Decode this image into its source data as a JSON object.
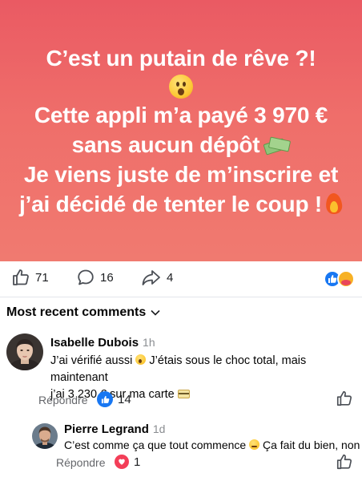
{
  "post": {
    "line1": "C’est un putain de rêve ?!",
    "line2": "Cette appli m’a payé 3 970 €",
    "line3": "sans aucun dépôt",
    "line4": "Je viens juste de m’inscrire et",
    "line5": "j’ai décidé de tenter le coup !",
    "emojis": [
      "astonished-face",
      "money-with-wings",
      "fire"
    ],
    "background_color": "#ea5a63"
  },
  "actions": {
    "likes": "71",
    "comments": "16",
    "shares": "4",
    "reactions": [
      "like",
      "care"
    ]
  },
  "comments_header": {
    "sort_label": "Most recent comments"
  },
  "comments": [
    {
      "author": "Isabelle Dubois",
      "time": "1h",
      "text_line1": "J’ai vérifié aussi",
      "text_line1_b": "J’étais sous le choc total, mais maintenant",
      "text_line2": "j’ai 3 230 € sur ma carte",
      "reply_label": "Répondre",
      "reaction_count": "14",
      "reaction": "like"
    },
    {
      "author": "Pierre Legrand",
      "time": "1d",
      "text_a": "C’est comme ça que tout commence",
      "text_b": "Ça fait du bien, non ?",
      "reply_label": "Répondre",
      "reaction_count": "1",
      "reaction": "love"
    }
  ],
  "colors": {
    "accent_blue": "#1877f2",
    "love_red": "#f33e58",
    "secondary_text": "#65676b"
  }
}
